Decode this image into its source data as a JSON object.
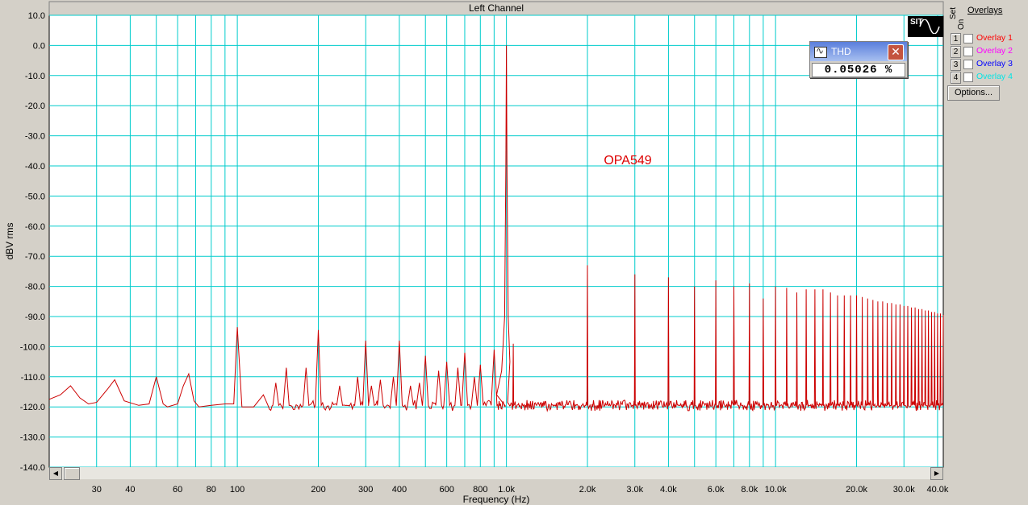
{
  "chart_data": {
    "type": "line",
    "title": "Left Channel",
    "xlabel": "Frequency (Hz)",
    "ylabel": "dBV rms",
    "xscale": "log",
    "xlim": [
      20,
      42000
    ],
    "ylim": [
      -140,
      10
    ],
    "grid": true,
    "annotation": "OPA549",
    "x_ticks": [
      {
        "v": 30,
        "label": "30"
      },
      {
        "v": 40,
        "label": "40"
      },
      {
        "v": 60,
        "label": "60"
      },
      {
        "v": 80,
        "label": "80"
      },
      {
        "v": 100,
        "label": "100"
      },
      {
        "v": 200,
        "label": "200"
      },
      {
        "v": 300,
        "label": "300"
      },
      {
        "v": 400,
        "label": "400"
      },
      {
        "v": 600,
        "label": "600"
      },
      {
        "v": 800,
        "label": "800"
      },
      {
        "v": 1000,
        "label": "1.0k"
      },
      {
        "v": 2000,
        "label": "2.0k"
      },
      {
        "v": 3000,
        "label": "3.0k"
      },
      {
        "v": 4000,
        "label": "4.0k"
      },
      {
        "v": 6000,
        "label": "6.0k"
      },
      {
        "v": 8000,
        "label": "8.0k"
      },
      {
        "v": 10000,
        "label": "10.0k"
      },
      {
        "v": 20000,
        "label": "20.0k"
      },
      {
        "v": 30000,
        "label": "30.0k"
      },
      {
        "v": 40000,
        "label": "40.0k"
      }
    ],
    "x_minor": [
      50,
      70,
      90,
      500,
      700,
      900,
      5000,
      7000,
      9000
    ],
    "y_ticks": [
      {
        "v": 10,
        "label": "10.0"
      },
      {
        "v": 0,
        "label": "0.0"
      },
      {
        "v": -10,
        "label": "-10.0"
      },
      {
        "v": -20,
        "label": "-20.0"
      },
      {
        "v": -30,
        "label": "-30.0"
      },
      {
        "v": -40,
        "label": "-40.0"
      },
      {
        "v": -50,
        "label": "-50.0"
      },
      {
        "v": -60,
        "label": "-60.0"
      },
      {
        "v": -70,
        "label": "-70.0"
      },
      {
        "v": -80,
        "label": "-80.0"
      },
      {
        "v": -90,
        "label": "-90.0"
      },
      {
        "v": -100,
        "label": "-100.0"
      },
      {
        "v": -110,
        "label": "-110.0"
      },
      {
        "v": -120,
        "label": "-120.0"
      },
      {
        "v": -130,
        "label": "-130.0"
      },
      {
        "v": -140,
        "label": "-140.0"
      }
    ],
    "series": [
      {
        "color": "#cc0000",
        "noise_floor": -119.5,
        "points": [
          [
            20,
            -117.5
          ],
          [
            22,
            -116
          ],
          [
            24,
            -113
          ],
          [
            26,
            -117
          ],
          [
            28,
            -119
          ],
          [
            30,
            -118.5
          ],
          [
            33,
            -114
          ],
          [
            35,
            -111
          ],
          [
            38,
            -118
          ],
          [
            43,
            -119.5
          ],
          [
            47,
            -119
          ],
          [
            50,
            -110
          ],
          [
            53,
            -119
          ],
          [
            55,
            -120
          ],
          [
            60,
            -119
          ],
          [
            63,
            -113
          ],
          [
            66,
            -109
          ],
          [
            69,
            -118
          ],
          [
            72,
            -120
          ],
          [
            80,
            -119.5
          ],
          [
            90,
            -119
          ],
          [
            97,
            -119
          ],
          [
            100,
            -93.5
          ],
          [
            104,
            -120
          ],
          [
            115,
            -120
          ],
          [
            125,
            -116
          ],
          [
            130,
            -119.5
          ]
        ],
        "peaks": [
          [
            139,
            -112
          ],
          [
            152,
            -107
          ],
          [
            180,
            -107
          ],
          [
            200,
            -94.5
          ],
          [
            240,
            -113
          ],
          [
            280,
            -110
          ],
          [
            300,
            -98
          ],
          [
            315,
            -113
          ],
          [
            340,
            -111
          ],
          [
            380,
            -110
          ],
          [
            400,
            -98
          ],
          [
            440,
            -113
          ],
          [
            475,
            -112
          ],
          [
            500,
            -103
          ],
          [
            560,
            -108
          ],
          [
            600,
            -105
          ],
          [
            660,
            -107
          ],
          [
            700,
            -102
          ],
          [
            760,
            -110
          ],
          [
            800,
            -106
          ],
          [
            900,
            -101
          ],
          [
            1000,
            0
          ],
          [
            1060,
            -99
          ],
          [
            2000,
            -73
          ],
          [
            3000,
            -76
          ],
          [
            4000,
            -77
          ],
          [
            5000,
            -80
          ],
          [
            6000,
            -78
          ],
          [
            7000,
            -80
          ],
          [
            8000,
            -79
          ],
          [
            9000,
            -84
          ],
          [
            10000,
            -80
          ],
          [
            11000,
            -80.5
          ],
          [
            12000,
            -82
          ],
          [
            13000,
            -81
          ],
          [
            14000,
            -81
          ],
          [
            15000,
            -81
          ],
          [
            16000,
            -82
          ],
          [
            17000,
            -83
          ],
          [
            18000,
            -83
          ],
          [
            19000,
            -83
          ],
          [
            20000,
            -83
          ],
          [
            21000,
            -83.5
          ],
          [
            22000,
            -84
          ],
          [
            23000,
            -84.5
          ],
          [
            24000,
            -85
          ],
          [
            25000,
            -85
          ],
          [
            26000,
            -85.5
          ],
          [
            27000,
            -85.5
          ],
          [
            28000,
            -86
          ],
          [
            29000,
            -86
          ],
          [
            30000,
            -86.5
          ],
          [
            31000,
            -86.5
          ],
          [
            32000,
            -87
          ],
          [
            33000,
            -87
          ],
          [
            34000,
            -87.5
          ],
          [
            35000,
            -87.5
          ],
          [
            36000,
            -88
          ],
          [
            37000,
            -88
          ],
          [
            38000,
            -88.5
          ],
          [
            39000,
            -88.5
          ],
          [
            40000,
            -89
          ],
          [
            41000,
            -89
          ],
          [
            42000,
            -89.5
          ]
        ]
      }
    ]
  },
  "thd": {
    "title": "THD",
    "value": "0.05026 %",
    "close": "✕"
  },
  "logo": {
    "text": "SIT"
  },
  "overlays": {
    "title": "Overlays",
    "set_label": "Set",
    "on_label": "On",
    "items": [
      {
        "num": "1",
        "label": "Overlay 1",
        "color": "#ff0000"
      },
      {
        "num": "2",
        "label": "Overlay 2",
        "color": "#ff00ff"
      },
      {
        "num": "3",
        "label": "Overlay 3",
        "color": "#0000ff"
      },
      {
        "num": "4",
        "label": "Overlay 4",
        "color": "#00e5e5"
      }
    ],
    "options_label": "Options..."
  },
  "scrollbar": {
    "left_arrow": "◀",
    "right_arrow": "▶"
  }
}
